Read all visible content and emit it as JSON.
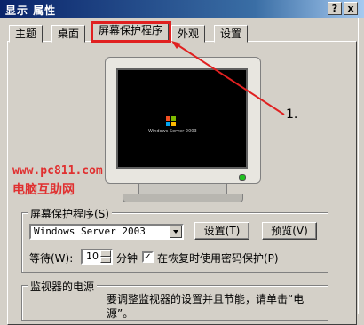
{
  "window": {
    "title": "显示 属性",
    "help_glyph": "?",
    "close_glyph": "x"
  },
  "tabs": [
    {
      "label": "主题"
    },
    {
      "label": "桌面"
    },
    {
      "label": "屏幕保护程序",
      "active": true
    },
    {
      "label": "外观"
    },
    {
      "label": "设置"
    }
  ],
  "annotation": {
    "label": "1.",
    "color": "#e02020"
  },
  "preview": {
    "screen_text": "Windows Server 2003"
  },
  "watermark": {
    "line1": "www.pc811.com",
    "line2": "电脑互助网"
  },
  "screensaver": {
    "group_label": "屏幕保护程序(S)",
    "selected": "Windows Server 2003",
    "settings_button": "设置(T)",
    "preview_button": "预览(V)",
    "wait_label": "等待(W):",
    "wait_value": "10",
    "minutes_label": "分钟",
    "password_checkbox_label": "在恢复时使用密码保护(P)",
    "password_checked": true
  },
  "power": {
    "group_label": "监视器的电源",
    "description": "要调整监视器的设置并且节能，请单击“电源”。"
  }
}
